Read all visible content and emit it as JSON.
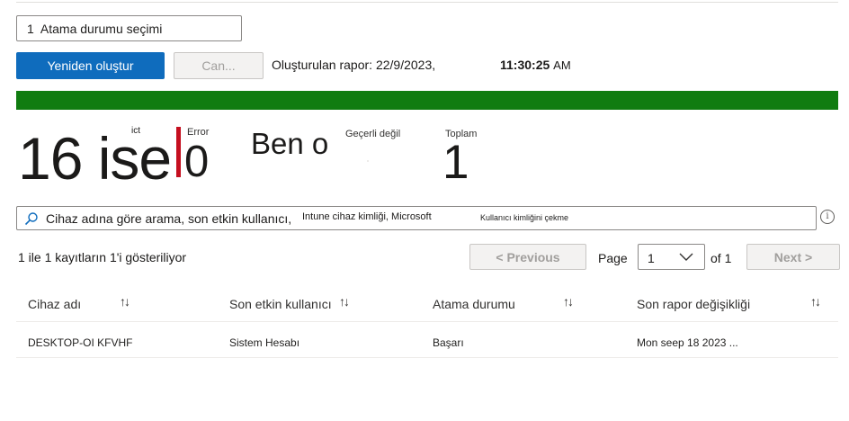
{
  "filter": {
    "count": "1",
    "label": "Atama durumu seçimi"
  },
  "toolbar": {
    "regenerate_label": "Yeniden oluştur",
    "cancel_label": "Can...",
    "report_label": "Oluşturulan rapor: 22/9/2023,",
    "report_time": "11:30:25",
    "report_ampm": "AM"
  },
  "progress": {
    "success_fraction": 1.0,
    "color": "#107c10"
  },
  "summary": {
    "success_value": "16 ise",
    "success_tiny": "ict",
    "error_label": "Error",
    "error_value": "0",
    "error_color": "#c50f1f",
    "ben_text": "Ben o",
    "not_applicable_label": "Geçerli değil",
    "total_label": "Toplam",
    "total_value": "1"
  },
  "search": {
    "placeholder": "Cihaz adına göre arama, son etkin kullanıcı,",
    "hint1": "Intune cihaz kimliği, Microsoft",
    "hint2": "Kullanıcı kimliğini çekme"
  },
  "pagination": {
    "records_text": "1 ile 1 kayıtların 1'i gösteriliyor",
    "previous_label": "< Previous",
    "page_label": "Page",
    "page_value": "1",
    "of_label": "of 1",
    "next_label": "Next >"
  },
  "table": {
    "sort_glyph": "↑↓",
    "columns": [
      "Cihaz adı",
      "Son etkin kullanıcı",
      "Atama durumu",
      "Son rapor değişikliği"
    ],
    "rows": [
      [
        "DESKTOP-OI KFVHF",
        "Sistem Hesabı",
        "Başarı",
        "Mon seep 18 2023 ..."
      ]
    ]
  }
}
